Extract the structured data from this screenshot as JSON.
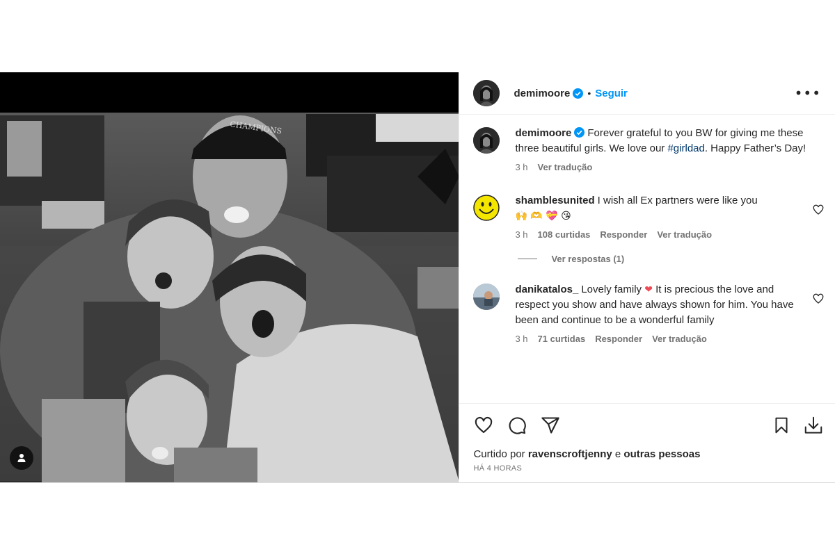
{
  "post": {
    "username": "demimoore",
    "follow_label": "Seguir",
    "dot": "•",
    "more_label": "•••"
  },
  "caption": {
    "username": "demimoore",
    "text_before": "Forever grateful to you BW for giving me these three beautiful girls. We love our ",
    "hashtag": "#girldad",
    "text_after": ". Happy Father’s Day!",
    "time": "3 h",
    "translate": "Ver tradução"
  },
  "comments": [
    {
      "username": "shamblesunited",
      "text": "I wish all Ex partners were like you",
      "emojis": "🙌 🫶 💝 😘",
      "time": "3 h",
      "likes": "108 curtidas",
      "reply": "Responder",
      "translate": "Ver tradução",
      "view_replies": "Ver respostas (1)"
    },
    {
      "username": "danikatalos_",
      "text_before": "Lovely family ",
      "heart_emoji": "❤",
      "text_after": " It is precious the love and respect you show and have always shown for him. You have been and continue to be a wonderful family",
      "time": "3 h",
      "likes": "71 curtidas",
      "reply": "Responder",
      "translate": "Ver tradução"
    }
  ],
  "likes_line": {
    "prefix": "Curtido por ",
    "user": "ravenscroftjenny",
    "middle": " e ",
    "others": "outras pessoas"
  },
  "timestamp": "HÁ 4 HORAS",
  "colors": {
    "accent": "#0095f6",
    "verified": "#0095f6",
    "hashtag": "#00376b",
    "heart": "#ed4956"
  },
  "icons": [
    "heart-icon",
    "comment-icon",
    "share-icon",
    "bookmark-icon",
    "download-icon",
    "user-tag-icon",
    "verified-badge-icon",
    "more-icon"
  ]
}
